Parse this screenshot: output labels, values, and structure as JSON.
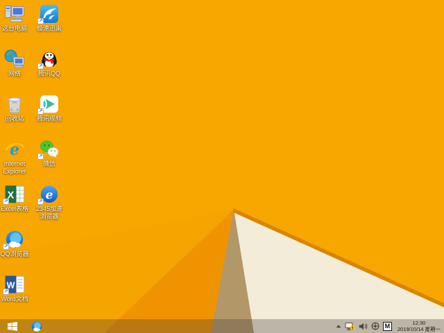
{
  "wallpaper": {
    "base": "#F8A701",
    "facet_left": "#F6A500",
    "facet_mid": "#EF9400",
    "fold_tan": "#B29768",
    "fold_cream": "#F2ECD8",
    "fold_edge_shadow": "#D98500",
    "fold_edge_highlight": "#FFC23E"
  },
  "desktop": {
    "icons": [
      {
        "name": "this-pc",
        "label": "这台电脑",
        "icon": "computer-icon",
        "shortcut": false,
        "col": 0,
        "row": 0
      },
      {
        "name": "xunlei",
        "label": "极速迅雷",
        "icon": "xunlei-bird-icon",
        "shortcut": true,
        "col": 1,
        "row": 0
      },
      {
        "name": "network",
        "label": "网络",
        "icon": "network-globe-icon",
        "shortcut": false,
        "col": 0,
        "row": 1
      },
      {
        "name": "tencent-qq",
        "label": "腾讯QQ",
        "icon": "qq-penguin-icon",
        "shortcut": true,
        "col": 1,
        "row": 1
      },
      {
        "name": "recycle-bin",
        "label": "回收站",
        "icon": "recycle-bin-icon",
        "shortcut": false,
        "col": 0,
        "row": 2
      },
      {
        "name": "tencent-video",
        "label": "腾讯视频",
        "icon": "tencent-video-icon",
        "shortcut": true,
        "col": 1,
        "row": 2
      },
      {
        "name": "internet-explorer",
        "label": "Internet Explorer",
        "icon": "ie-icon",
        "shortcut": false,
        "col": 0,
        "row": 3
      },
      {
        "name": "wechat",
        "label": "微信",
        "icon": "wechat-icon",
        "shortcut": true,
        "col": 1,
        "row": 3
      },
      {
        "name": "excel",
        "label": "Excel表格",
        "icon": "excel-icon",
        "shortcut": true,
        "col": 0,
        "row": 4
      },
      {
        "name": "2345-browser",
        "label": "2345加速浏览器",
        "icon": "2345-browser-icon",
        "shortcut": true,
        "col": 1,
        "row": 4
      },
      {
        "name": "qq-browser",
        "label": "QQ浏览器",
        "icon": "qq-browser-icon",
        "shortcut": true,
        "col": 0,
        "row": 5
      },
      {
        "name": "word",
        "label": "Word文档",
        "icon": "word-icon",
        "shortcut": true,
        "col": 0,
        "row": 6
      }
    ]
  },
  "taskbar": {
    "start_button": {
      "icon": "windows-logo-icon"
    },
    "pinned": [
      {
        "name": "qq-browser",
        "icon": "qq-browser-icon"
      }
    ],
    "tray": {
      "show_hidden_icons": {
        "icon": "chevron-up-icon"
      },
      "network": {
        "icon": "network-warning-icon"
      },
      "volume": {
        "icon": "speaker-icon"
      },
      "safety": {
        "icon": "safety-center-icon"
      },
      "ime_indicator": "M",
      "clock": {
        "time": "12:30",
        "date": "2019/10/14 星期一"
      }
    }
  }
}
